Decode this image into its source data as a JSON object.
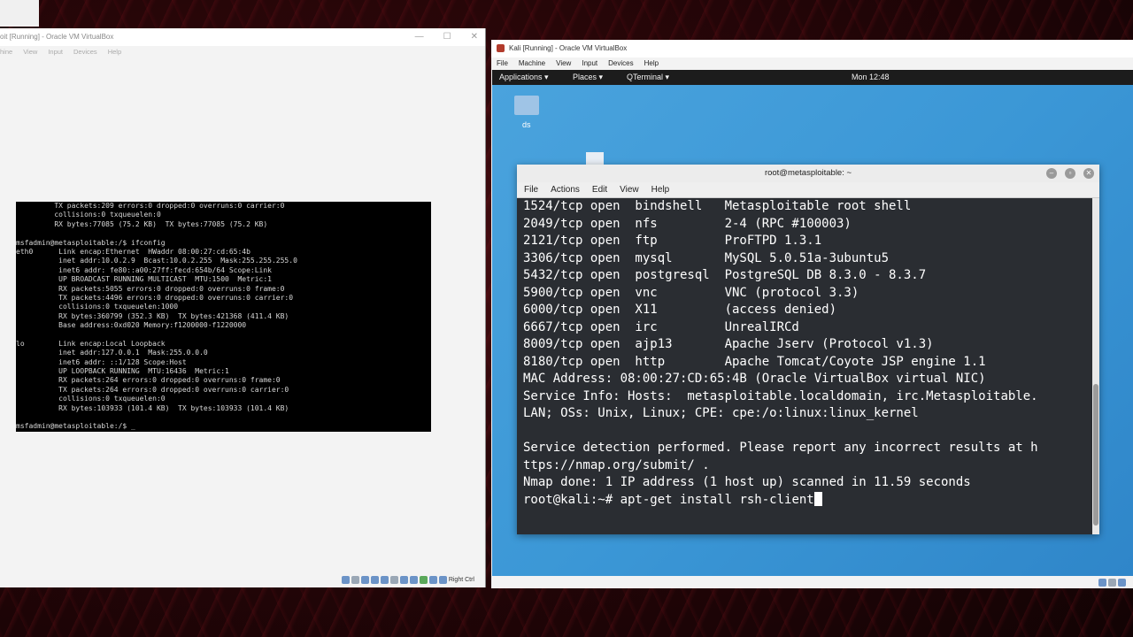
{
  "left_window": {
    "title": "oit [Running] - Oracle VM VirtualBox",
    "menu": [
      "hine",
      "View",
      "Input",
      "Devices",
      "Help"
    ],
    "console_lines": [
      "         TX packets:209 errors:0 dropped:0 overruns:0 carrier:0",
      "         collisions:0 txqueuelen:0",
      "         RX bytes:77085 (75.2 KB)  TX bytes:77085 (75.2 KB)",
      "",
      "msfadmin@metasploitable:/$ ifconfig",
      "eth0      Link encap:Ethernet  HWaddr 08:00:27:cd:65:4b",
      "          inet addr:10.0.2.9  Bcast:10.0.2.255  Mask:255.255.255.0",
      "          inet6 addr: fe80::a00:27ff:fecd:654b/64 Scope:Link",
      "          UP BROADCAST RUNNING MULTICAST  MTU:1500  Metric:1",
      "          RX packets:5055 errors:0 dropped:0 overruns:0 frame:0",
      "          TX packets:4496 errors:0 dropped:0 overruns:0 carrier:0",
      "          collisions:0 txqueuelen:1000",
      "          RX bytes:360799 (352.3 KB)  TX bytes:421368 (411.4 KB)",
      "          Base address:0xd020 Memory:f1200000-f1220000",
      "",
      "lo        Link encap:Local Loopback",
      "          inet addr:127.0.0.1  Mask:255.0.0.0",
      "          inet6 addr: ::1/128 Scope:Host",
      "          UP LOOPBACK RUNNING  MTU:16436  Metric:1",
      "          RX packets:264 errors:0 dropped:0 overruns:0 frame:0",
      "          TX packets:264 errors:0 dropped:0 overruns:0 carrier:0",
      "          collisions:0 txqueuelen:0",
      "          RX bytes:103933 (101.4 KB)  TX bytes:103933 (101.4 KB)",
      "",
      "msfadmin@metasploitable:/$ _"
    ],
    "status_label": "Right Ctrl"
  },
  "right_window": {
    "title": "Kali [Running] - Oracle VM VirtualBox",
    "menu": [
      "File",
      "Machine",
      "View",
      "Input",
      "Devices",
      "Help"
    ],
    "status_label": ""
  },
  "kali_topbar": {
    "applications": "Applications ▾",
    "places": "Places ▾",
    "qterminal": "QTerminal ▾",
    "clock": "Mon 12:48"
  },
  "desktop": {
    "folder_label": "ds"
  },
  "terminal": {
    "title": "root@metasploitable: ~",
    "menu": [
      "File",
      "Actions",
      "Edit",
      "View",
      "Help"
    ],
    "lines": [
      "1524/tcp open  bindshell   Metasploitable root shell",
      "2049/tcp open  nfs         2-4 (RPC #100003)",
      "2121/tcp open  ftp         ProFTPD 1.3.1",
      "3306/tcp open  mysql       MySQL 5.0.51a-3ubuntu5",
      "5432/tcp open  postgresql  PostgreSQL DB 8.3.0 - 8.3.7",
      "5900/tcp open  vnc         VNC (protocol 3.3)",
      "6000/tcp open  X11         (access denied)",
      "6667/tcp open  irc         UnrealIRCd",
      "8009/tcp open  ajp13       Apache Jserv (Protocol v1.3)",
      "8180/tcp open  http        Apache Tomcat/Coyote JSP engine 1.1",
      "MAC Address: 08:00:27:CD:65:4B (Oracle VirtualBox virtual NIC)",
      "Service Info: Hosts:  metasploitable.localdomain, irc.Metasploitable.",
      "LAN; OSs: Unix, Linux; CPE: cpe:/o:linux:linux_kernel",
      "",
      "Service detection performed. Please report any incorrect results at h",
      "ttps://nmap.org/submit/ .",
      "Nmap done: 1 IP address (1 host up) scanned in 11.59 seconds"
    ],
    "prompt": "root@kali:~# ",
    "command": "apt-get install rsh-client"
  }
}
